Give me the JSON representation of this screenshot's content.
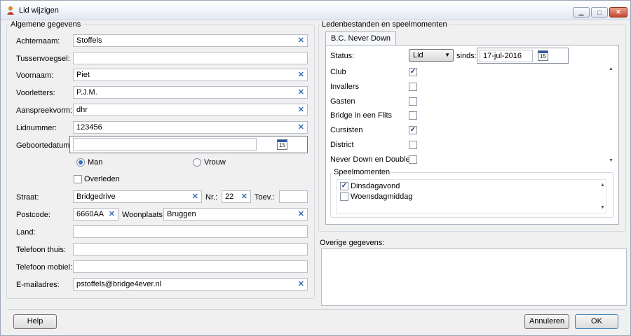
{
  "window": {
    "title": "Lid wijzigen",
    "controls": {
      "minimize": "▁",
      "maximize": "□",
      "close": "✕"
    }
  },
  "general": {
    "group_label": "Algemene gegevens",
    "achternaam": {
      "label": "Achternaam:",
      "value": "Stoffels"
    },
    "tussenvoegsel": {
      "label": "Tussenvoegsel:",
      "value": ""
    },
    "voornaam": {
      "label": "Voornaam:",
      "value": "Piet"
    },
    "voorletters": {
      "label": "Voorletters:",
      "value": "P.J.M."
    },
    "aanspreekvorm": {
      "label": "Aanspreekvorm:",
      "value": "dhr"
    },
    "lidnummer": {
      "label": "Lidnummer:",
      "value": "123456"
    },
    "geboortedatum": {
      "label": "Geboortedatum:",
      "value": ""
    },
    "gender": {
      "man": "Man",
      "vrouw": "Vrouw",
      "selected": "man"
    },
    "overleden": {
      "label": "Overleden",
      "checked": false
    },
    "straat": {
      "label": "Straat:",
      "value": "Bridgedrive"
    },
    "nr": {
      "label": "Nr.:",
      "value": "22"
    },
    "toev": {
      "label": "Toev.:",
      "value": ""
    },
    "postcode": {
      "label": "Postcode:",
      "value": "6660AA"
    },
    "woonplaats": {
      "label": "Woonplaats",
      "value": "Bruggen"
    },
    "land": {
      "label": "Land:",
      "value": ""
    },
    "telefoon_thuis": {
      "label": "Telefoon thuis:",
      "value": ""
    },
    "telefoon_mobiel": {
      "label": "Telefoon mobiel:",
      "value": ""
    },
    "email": {
      "label": "E-mailadres:",
      "value": "pstoffels@bridge4ever.nl"
    },
    "calendar_icon_text": "15",
    "clear_glyph": "✕"
  },
  "members": {
    "group_label": "Ledenbestanden en speelmomenten",
    "tab_label": "B.C. Never Down",
    "status_label": "Status:",
    "status_value": "Lid",
    "sinds_label": "sinds:",
    "sinds_value": "17-jul-2016",
    "categories": [
      {
        "label": "Club",
        "checked": true
      },
      {
        "label": "Invallers",
        "checked": false
      },
      {
        "label": "Gasten",
        "checked": false
      },
      {
        "label": "Bridge in een Flits",
        "checked": false
      },
      {
        "label": "Cursisten",
        "checked": true
      },
      {
        "label": "District",
        "checked": false
      },
      {
        "label": "Never Down en Doublet",
        "checked": false
      }
    ],
    "speelmomenten_label": "Speelmomenten",
    "speelmomenten": [
      {
        "label": "Dinsdagavond",
        "checked": true
      },
      {
        "label": "Woensdagmiddag",
        "checked": false
      }
    ]
  },
  "overige": {
    "label": "Overige gegevens:"
  },
  "buttons": {
    "help": "Help",
    "annuleren": "Annuleren",
    "ok": "OK"
  },
  "glyphs": {
    "check": "✓",
    "scroll_up": "▲",
    "scroll_down": "▼",
    "dropdown": "▼"
  }
}
